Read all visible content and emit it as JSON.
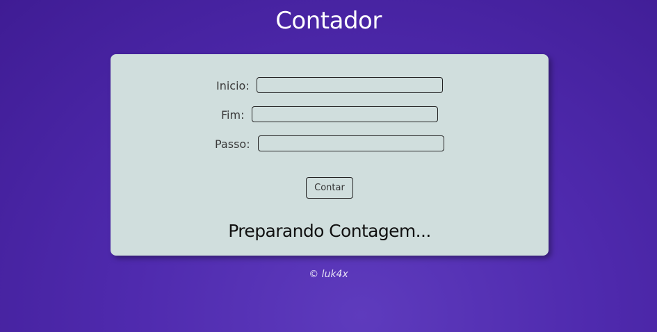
{
  "header": {
    "title": "Contador"
  },
  "form": {
    "inicio_label": "Inicio:",
    "inicio_value": "",
    "fim_label": "Fim:",
    "fim_value": "",
    "passo_label": "Passo:",
    "passo_value": "",
    "button_label": "Contar"
  },
  "result": {
    "text": "Preparando Contagem..."
  },
  "footer": {
    "text": "© luk4x"
  },
  "colors": {
    "background": "#4f2aae",
    "card": "#d0dedd",
    "title": "#ffffff"
  }
}
